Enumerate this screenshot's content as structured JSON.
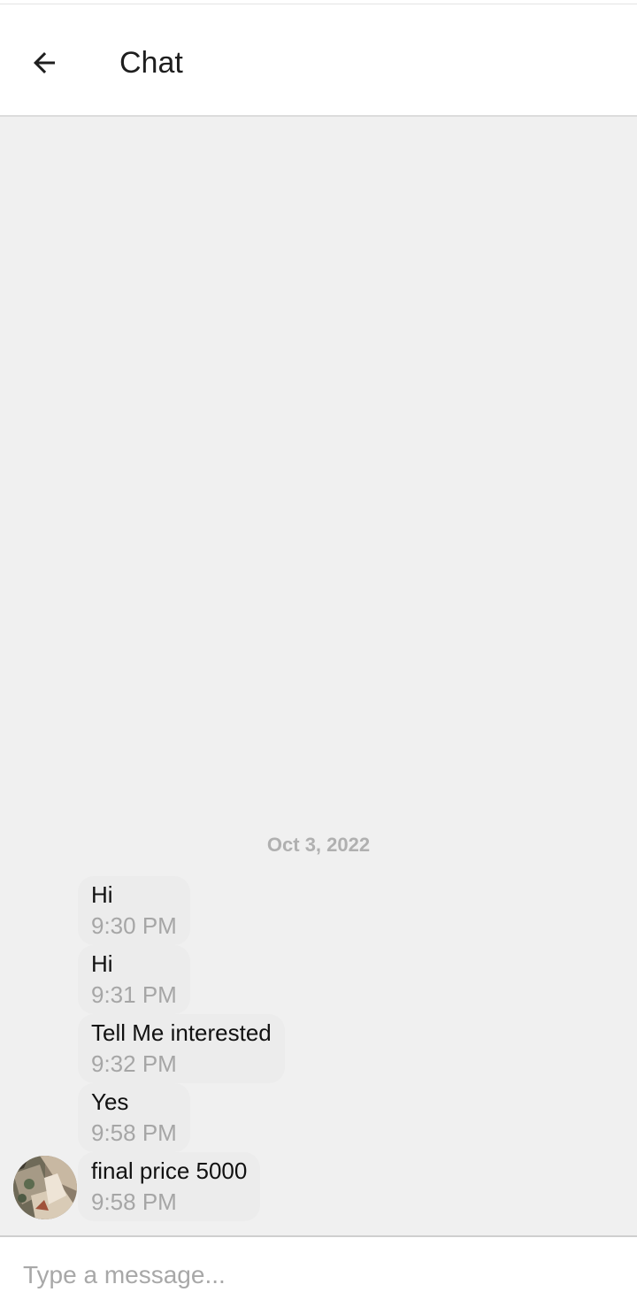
{
  "header": {
    "title": "Chat",
    "back_icon": "arrow-left-icon"
  },
  "conversation": {
    "date_separator": "Oct 3, 2022",
    "messages": [
      {
        "text": "Hi",
        "time": "9:30 PM"
      },
      {
        "text": "Hi",
        "time": "9:31 PM"
      },
      {
        "text": "Tell Me interested",
        "time": "9:32 PM"
      },
      {
        "text": "Yes",
        "time": "9:58 PM"
      },
      {
        "text": "final price 5000",
        "time": "9:58 PM"
      }
    ]
  },
  "composer": {
    "placeholder": "Type a message...",
    "value": ""
  },
  "colors": {
    "background": "#f0f0f0",
    "header_background": "#ffffff",
    "timestamp": "#a6a6a6",
    "date_separator": "#b0b0b0"
  }
}
